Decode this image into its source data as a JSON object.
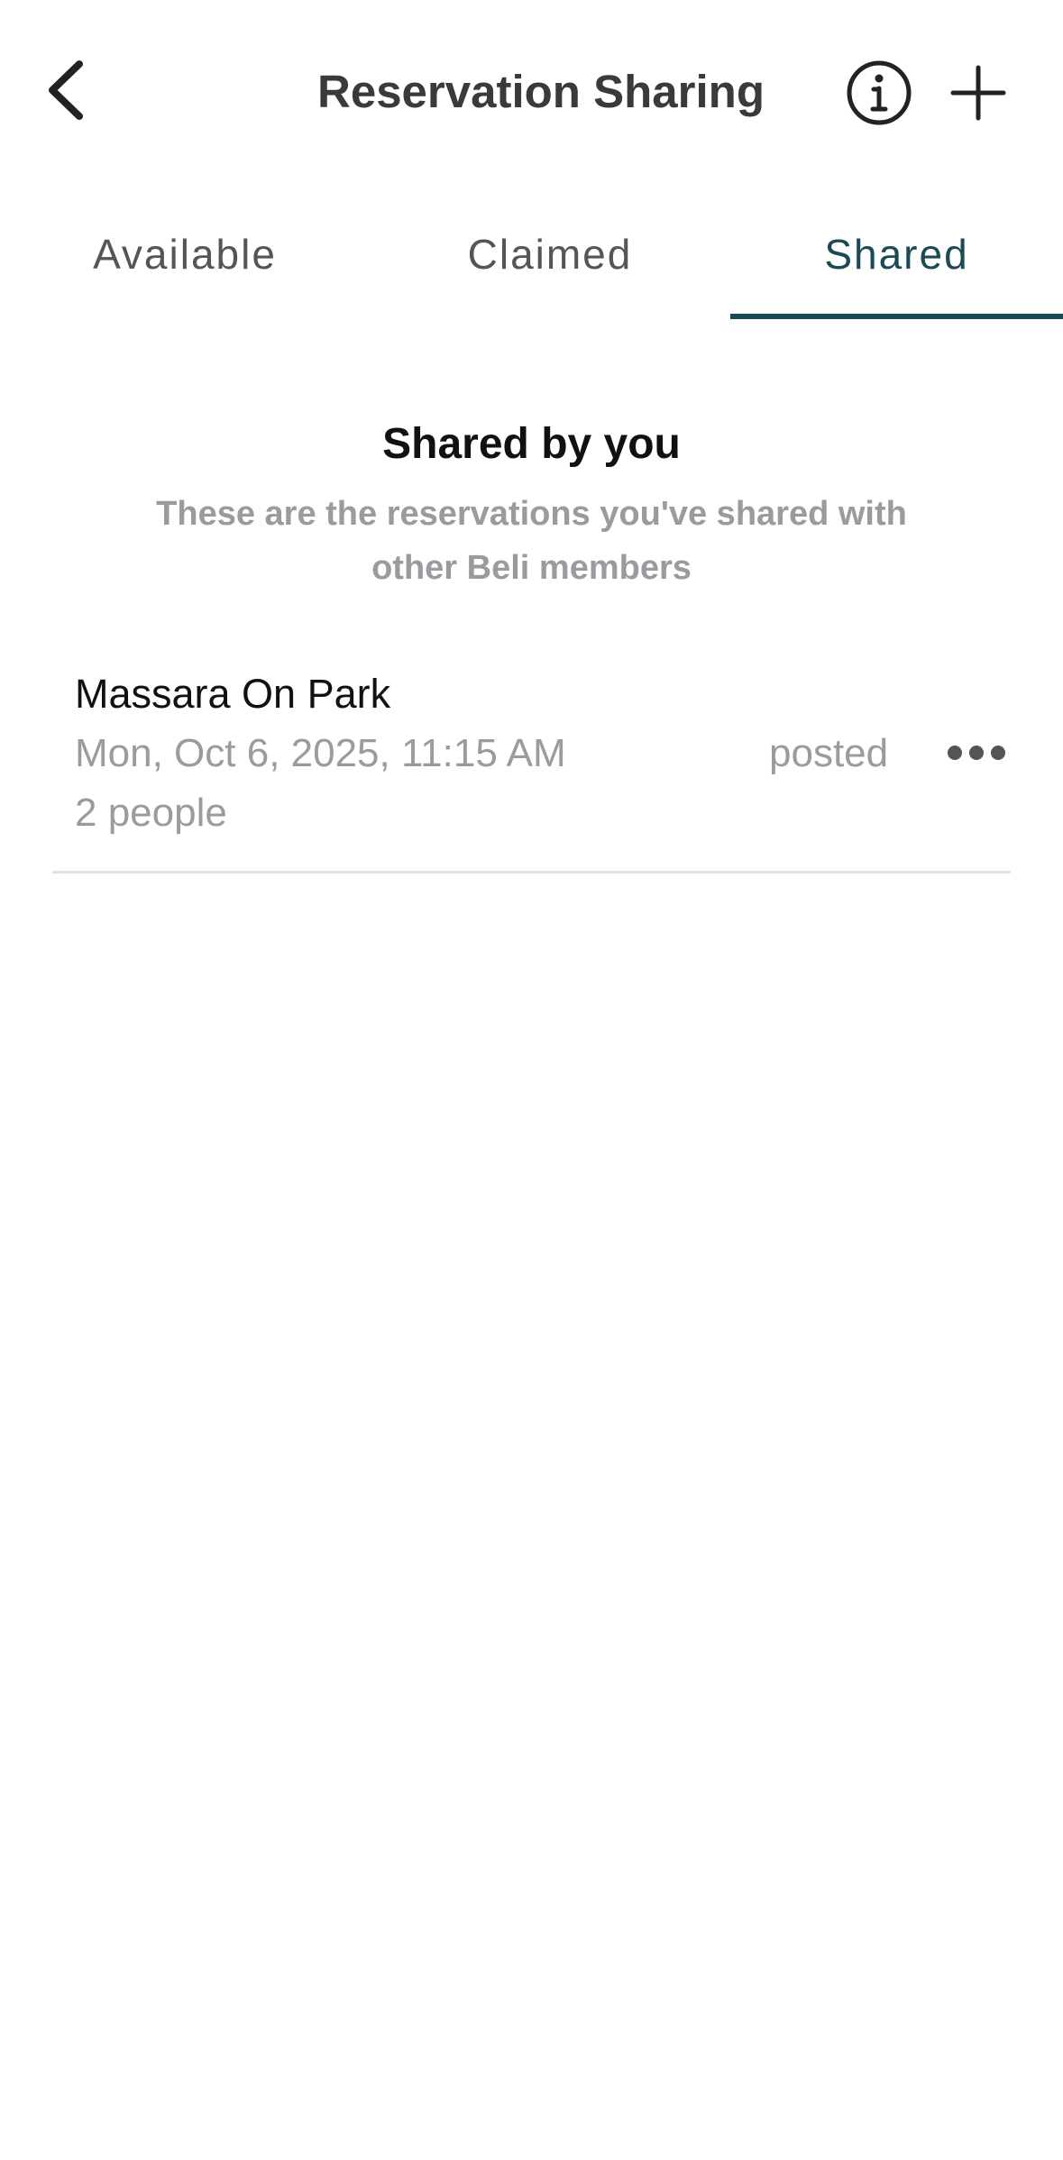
{
  "nav": {
    "title": "Reservation Sharing",
    "back_icon": "chevron-left-icon",
    "info_icon": "info-circle-icon",
    "add_icon": "plus-icon"
  },
  "tabs": [
    {
      "label": "Available",
      "selected": false
    },
    {
      "label": "Claimed",
      "selected": false
    },
    {
      "label": "Shared",
      "selected": true
    }
  ],
  "colors": {
    "accent": "#1b4a55",
    "muted_text": "#9b9b9f"
  },
  "section": {
    "title": "Shared by you",
    "subtitle": "These are the reservations you've shared with other Beli members"
  },
  "reservations": [
    {
      "restaurant": "Massara On Park",
      "datetime": "Mon, Oct 6, 2025, 11:15 AM",
      "party": "2 people",
      "status": "posted",
      "more_icon": "ellipsis-icon"
    }
  ]
}
